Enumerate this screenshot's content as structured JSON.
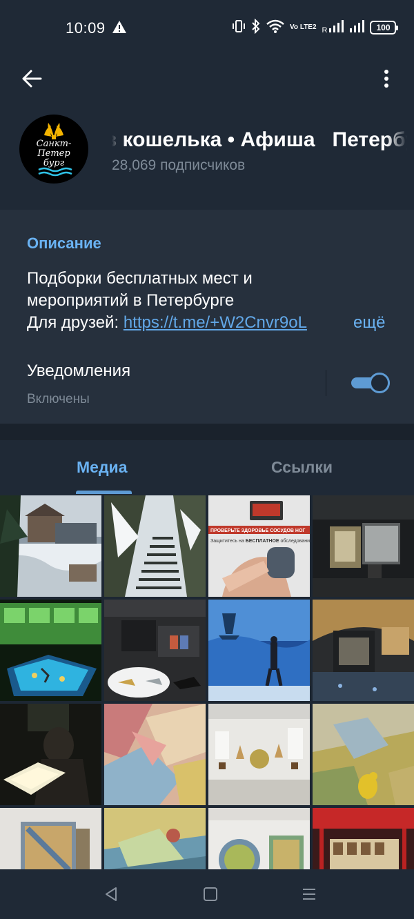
{
  "status_bar": {
    "time": "10:09",
    "network_label": "Vo LTE2",
    "signal_roaming": "R",
    "battery": "100"
  },
  "header": {
    "avatar_text": "Санкт-\nПетер\nбург",
    "title": "Без кошелька • Афиша   Петербург",
    "subscribers": "28,069 подписчиков"
  },
  "info": {
    "description_label": "Описание",
    "description_line1": "Подборки бесплатных мест и",
    "description_line2": "мероприятий в Петербурге",
    "description_line3_prefix": "Для друзей: ",
    "description_link": "https://t.me/+W2Cnvr9oL",
    "more_label": "ещё",
    "notifications_label": "Уведомления",
    "notifications_status": "Включены",
    "notifications_enabled": true
  },
  "tabs": {
    "media": "Медиа",
    "links": "Ссылки",
    "active": "media"
  },
  "media": {
    "photo3_caption_top": "ПРОВЕРЬТЕ ЗДОРОВЬЕ СОСУДОВ НОГ",
    "photo3_caption_prefix": "Защититесь на ",
    "photo3_caption_bold": "БЕСПЛАТНОЕ",
    "photo3_caption_suffix": " обследование"
  },
  "colors": {
    "accent": "#6ab2f2",
    "background": "#1d2733",
    "header": "#1f2936",
    "section": "#26303d",
    "muted_text": "#7e8a97"
  }
}
